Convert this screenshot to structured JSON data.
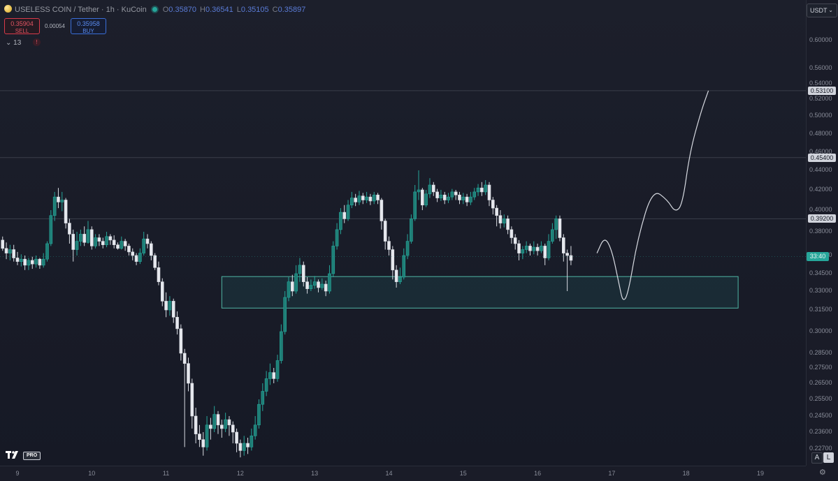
{
  "symbol": {
    "title": "USELESS COIN / Tether · 1h · KuCoin",
    "open_key": "O",
    "open": "0.35870",
    "high_key": "H",
    "high": "0.36541",
    "low_key": "L",
    "low": "0.35105",
    "close_key": "C",
    "close": "0.35897"
  },
  "trade": {
    "sell_price": "0.35904",
    "sell_label": "SELL",
    "spread": "0.00054",
    "buy_price": "0.35958",
    "buy_label": "BUY"
  },
  "indicators_toggle": "⌄ 13",
  "alert_glyph": "!",
  "currency": {
    "label": "USDT",
    "chevron": "⌄"
  },
  "price_axis": {
    "ticks": [
      "0.60000",
      "0.56000",
      "0.54000",
      "0.52000",
      "0.50000",
      "0.48000",
      "0.46000",
      "0.44000",
      "0.42000",
      "0.40000",
      "0.38000",
      "0.36000",
      "0.34500",
      "0.33000",
      "0.31500",
      "0.30000",
      "0.28500",
      "0.27500",
      "0.26500",
      "0.25500",
      "0.24500",
      "0.23600",
      "0.22700"
    ],
    "horizontal_lines": [
      {
        "label": "0.53100",
        "price": 0.531
      },
      {
        "label": "0.45400",
        "price": 0.454
      },
      {
        "label": "0.39200",
        "price": 0.392
      }
    ],
    "countdown": "33:40",
    "last_price": 0.359
  },
  "time_axis": {
    "ticks": [
      "9",
      "10",
      "11",
      "12",
      "13",
      "14",
      "15",
      "16",
      "17",
      "18",
      "19"
    ]
  },
  "support_zone": {
    "top": 0.3425,
    "bottom": 0.3165,
    "from_day": 11.75,
    "to_day": 18.7
  },
  "projection": {
    "points": [
      [
        16.8,
        0.362
      ],
      [
        16.9,
        0.376
      ],
      [
        17.0,
        0.365
      ],
      [
        17.1,
        0.335
      ],
      [
        17.15,
        0.321
      ],
      [
        17.22,
        0.328
      ],
      [
        17.35,
        0.375
      ],
      [
        17.55,
        0.421
      ],
      [
        17.75,
        0.41
      ],
      [
        17.85,
        0.398
      ],
      [
        17.95,
        0.405
      ],
      [
        18.05,
        0.46
      ],
      [
        18.2,
        0.505
      ],
      [
        18.3,
        0.531
      ]
    ]
  },
  "chart_data": {
    "type": "candlestick",
    "title": "USELESS COIN / Tether · 1h · KuCoin",
    "xlabel": "",
    "ylabel": "",
    "ylim": [
      0.22,
      0.61
    ],
    "xlim": [
      8.78,
      19.3
    ],
    "candles": [
      [
        8.8,
        0.373,
        0.366,
        0.376,
        0.364
      ],
      [
        8.85,
        0.366,
        0.362,
        0.371,
        0.357
      ],
      [
        8.9,
        0.362,
        0.365,
        0.369,
        0.356
      ],
      [
        8.95,
        0.365,
        0.358,
        0.369,
        0.355
      ],
      [
        9.0,
        0.358,
        0.355,
        0.363,
        0.352
      ],
      [
        9.05,
        0.355,
        0.357,
        0.361,
        0.351
      ],
      [
        9.1,
        0.357,
        0.352,
        0.36,
        0.348
      ],
      [
        9.15,
        0.352,
        0.356,
        0.358,
        0.348
      ],
      [
        9.2,
        0.356,
        0.353,
        0.359,
        0.349
      ],
      [
        9.25,
        0.353,
        0.357,
        0.36,
        0.35
      ],
      [
        9.3,
        0.357,
        0.352,
        0.358,
        0.349
      ],
      [
        9.35,
        0.352,
        0.357,
        0.362,
        0.35
      ],
      [
        9.4,
        0.357,
        0.37,
        0.372,
        0.355
      ],
      [
        9.45,
        0.37,
        0.395,
        0.4,
        0.368
      ],
      [
        9.5,
        0.395,
        0.413,
        0.418,
        0.39
      ],
      [
        9.55,
        0.413,
        0.408,
        0.422,
        0.402
      ],
      [
        9.6,
        0.408,
        0.41,
        0.418,
        0.399
      ],
      [
        9.65,
        0.41,
        0.388,
        0.412,
        0.383
      ],
      [
        9.7,
        0.388,
        0.378,
        0.392,
        0.37
      ],
      [
        9.75,
        0.378,
        0.365,
        0.382,
        0.355
      ],
      [
        9.8,
        0.365,
        0.372,
        0.38,
        0.36
      ],
      [
        9.85,
        0.372,
        0.378,
        0.382,
        0.368
      ],
      [
        9.9,
        0.378,
        0.371,
        0.385,
        0.368
      ],
      [
        9.95,
        0.371,
        0.382,
        0.39,
        0.37
      ],
      [
        10.0,
        0.382,
        0.368,
        0.385,
        0.365
      ],
      [
        10.05,
        0.368,
        0.375,
        0.378,
        0.366
      ],
      [
        10.1,
        0.375,
        0.372,
        0.378,
        0.368
      ],
      [
        10.15,
        0.372,
        0.369,
        0.375,
        0.366
      ],
      [
        10.2,
        0.369,
        0.376,
        0.38,
        0.367
      ],
      [
        10.25,
        0.376,
        0.373,
        0.378,
        0.369
      ],
      [
        10.3,
        0.373,
        0.369,
        0.377,
        0.366
      ],
      [
        10.35,
        0.369,
        0.366,
        0.371,
        0.365
      ],
      [
        10.4,
        0.366,
        0.372,
        0.376,
        0.365
      ],
      [
        10.45,
        0.372,
        0.368,
        0.374,
        0.364
      ],
      [
        10.5,
        0.368,
        0.363,
        0.37,
        0.36
      ],
      [
        10.55,
        0.363,
        0.36,
        0.366,
        0.356
      ],
      [
        10.6,
        0.36,
        0.355,
        0.362,
        0.352
      ],
      [
        10.65,
        0.355,
        0.362,
        0.366,
        0.353
      ],
      [
        10.7,
        0.362,
        0.374,
        0.38,
        0.36
      ],
      [
        10.75,
        0.374,
        0.37,
        0.378,
        0.366
      ],
      [
        10.8,
        0.37,
        0.36,
        0.372,
        0.356
      ],
      [
        10.85,
        0.36,
        0.35,
        0.362,
        0.348
      ],
      [
        10.9,
        0.35,
        0.338,
        0.355,
        0.335
      ],
      [
        10.95,
        0.338,
        0.322,
        0.341,
        0.318
      ],
      [
        11.0,
        0.322,
        0.315,
        0.329,
        0.31
      ],
      [
        11.05,
        0.315,
        0.322,
        0.326,
        0.311
      ],
      [
        11.1,
        0.322,
        0.31,
        0.324,
        0.306
      ],
      [
        11.15,
        0.31,
        0.302,
        0.314,
        0.298
      ],
      [
        11.2,
        0.302,
        0.285,
        0.305,
        0.28
      ],
      [
        11.25,
        0.285,
        0.278,
        0.288,
        0.228
      ],
      [
        11.3,
        0.278,
        0.265,
        0.282,
        0.26
      ],
      [
        11.35,
        0.265,
        0.245,
        0.268,
        0.238
      ],
      [
        11.4,
        0.245,
        0.235,
        0.25,
        0.23
      ],
      [
        11.45,
        0.235,
        0.232,
        0.24,
        0.228
      ],
      [
        11.5,
        0.232,
        0.228,
        0.236,
        0.223
      ],
      [
        11.55,
        0.228,
        0.24,
        0.245,
        0.226
      ],
      [
        11.6,
        0.24,
        0.238,
        0.244,
        0.232
      ],
      [
        11.65,
        0.238,
        0.246,
        0.251,
        0.236
      ],
      [
        11.7,
        0.246,
        0.24,
        0.248,
        0.235
      ],
      [
        11.75,
        0.24,
        0.238,
        0.243,
        0.233
      ],
      [
        11.8,
        0.238,
        0.243,
        0.247,
        0.236
      ],
      [
        11.85,
        0.243,
        0.24,
        0.245,
        0.234
      ],
      [
        11.9,
        0.24,
        0.236,
        0.242,
        0.23
      ],
      [
        11.95,
        0.236,
        0.23,
        0.238,
        0.225
      ],
      [
        12.0,
        0.23,
        0.226,
        0.232,
        0.222
      ],
      [
        12.05,
        0.226,
        0.23,
        0.234,
        0.223
      ],
      [
        12.1,
        0.23,
        0.228,
        0.233,
        0.224
      ],
      [
        12.15,
        0.228,
        0.234,
        0.238,
        0.226
      ],
      [
        12.2,
        0.234,
        0.24,
        0.245,
        0.232
      ],
      [
        12.25,
        0.24,
        0.252,
        0.255,
        0.238
      ],
      [
        12.3,
        0.252,
        0.26,
        0.265,
        0.248
      ],
      [
        12.35,
        0.26,
        0.268,
        0.273,
        0.257
      ],
      [
        12.4,
        0.268,
        0.272,
        0.278,
        0.264
      ],
      [
        12.45,
        0.272,
        0.268,
        0.275,
        0.265
      ],
      [
        12.5,
        0.268,
        0.28,
        0.284,
        0.266
      ],
      [
        12.55,
        0.28,
        0.3,
        0.305,
        0.278
      ],
      [
        12.6,
        0.3,
        0.325,
        0.33,
        0.298
      ],
      [
        12.65,
        0.325,
        0.338,
        0.342,
        0.322
      ],
      [
        12.7,
        0.338,
        0.33,
        0.344,
        0.326
      ],
      [
        12.75,
        0.33,
        0.345,
        0.352,
        0.328
      ],
      [
        12.8,
        0.345,
        0.352,
        0.358,
        0.338
      ],
      [
        12.85,
        0.352,
        0.338,
        0.355,
        0.334
      ],
      [
        12.9,
        0.338,
        0.332,
        0.342,
        0.328
      ],
      [
        12.95,
        0.332,
        0.335,
        0.34,
        0.33
      ],
      [
        13.0,
        0.335,
        0.338,
        0.343,
        0.332
      ],
      [
        13.05,
        0.338,
        0.333,
        0.34,
        0.329
      ],
      [
        13.1,
        0.333,
        0.336,
        0.341,
        0.331
      ],
      [
        13.15,
        0.336,
        0.33,
        0.339,
        0.326
      ],
      [
        13.2,
        0.33,
        0.345,
        0.352,
        0.328
      ],
      [
        13.25,
        0.345,
        0.368,
        0.372,
        0.342
      ],
      [
        13.3,
        0.368,
        0.382,
        0.388,
        0.365
      ],
      [
        13.35,
        0.382,
        0.398,
        0.402,
        0.378
      ],
      [
        13.4,
        0.398,
        0.392,
        0.405,
        0.388
      ],
      [
        13.45,
        0.392,
        0.405,
        0.41,
        0.39
      ],
      [
        13.5,
        0.405,
        0.412,
        0.418,
        0.402
      ],
      [
        13.55,
        0.412,
        0.408,
        0.416,
        0.404
      ],
      [
        13.6,
        0.408,
        0.414,
        0.419,
        0.405
      ],
      [
        13.65,
        0.414,
        0.41,
        0.417,
        0.406
      ],
      [
        13.7,
        0.41,
        0.413,
        0.418,
        0.407
      ],
      [
        13.75,
        0.413,
        0.409,
        0.416,
        0.405
      ],
      [
        13.8,
        0.409,
        0.415,
        0.418,
        0.406
      ],
      [
        13.85,
        0.415,
        0.41,
        0.417,
        0.406
      ],
      [
        13.9,
        0.41,
        0.39,
        0.412,
        0.382
      ],
      [
        13.95,
        0.39,
        0.372,
        0.392,
        0.365
      ],
      [
        14.0,
        0.372,
        0.365,
        0.376,
        0.36
      ],
      [
        14.05,
        0.365,
        0.348,
        0.368,
        0.34
      ],
      [
        14.1,
        0.348,
        0.338,
        0.352,
        0.333
      ],
      [
        14.15,
        0.338,
        0.342,
        0.35,
        0.336
      ],
      [
        14.2,
        0.342,
        0.36,
        0.366,
        0.34
      ],
      [
        14.25,
        0.36,
        0.372,
        0.378,
        0.357
      ],
      [
        14.3,
        0.372,
        0.392,
        0.396,
        0.37
      ],
      [
        14.35,
        0.392,
        0.418,
        0.425,
        0.39
      ],
      [
        14.4,
        0.418,
        0.42,
        0.44,
        0.41
      ],
      [
        14.45,
        0.42,
        0.405,
        0.422,
        0.4
      ],
      [
        14.5,
        0.405,
        0.416,
        0.42,
        0.403
      ],
      [
        14.55,
        0.416,
        0.425,
        0.432,
        0.412
      ],
      [
        14.6,
        0.425,
        0.418,
        0.428,
        0.414
      ],
      [
        14.65,
        0.418,
        0.412,
        0.421,
        0.408
      ],
      [
        14.7,
        0.412,
        0.415,
        0.42,
        0.409
      ],
      [
        14.75,
        0.415,
        0.41,
        0.418,
        0.406
      ],
      [
        14.8,
        0.41,
        0.413,
        0.417,
        0.407
      ],
      [
        14.85,
        0.413,
        0.418,
        0.421,
        0.41
      ],
      [
        14.9,
        0.418,
        0.415,
        0.42,
        0.41
      ],
      [
        14.95,
        0.415,
        0.41,
        0.418,
        0.406
      ],
      [
        15.0,
        0.41,
        0.413,
        0.417,
        0.406
      ],
      [
        15.05,
        0.413,
        0.408,
        0.416,
        0.404
      ],
      [
        15.1,
        0.408,
        0.413,
        0.418,
        0.405
      ],
      [
        15.15,
        0.413,
        0.418,
        0.422,
        0.41
      ],
      [
        15.2,
        0.418,
        0.422,
        0.426,
        0.414
      ],
      [
        15.25,
        0.422,
        0.418,
        0.428,
        0.414
      ],
      [
        15.3,
        0.418,
        0.425,
        0.43,
        0.415
      ],
      [
        15.35,
        0.425,
        0.41,
        0.428,
        0.404
      ],
      [
        15.4,
        0.41,
        0.402,
        0.413,
        0.396
      ],
      [
        15.45,
        0.402,
        0.395,
        0.405,
        0.385
      ],
      [
        15.5,
        0.395,
        0.388,
        0.4,
        0.383
      ],
      [
        15.55,
        0.388,
        0.392,
        0.396,
        0.384
      ],
      [
        15.6,
        0.392,
        0.382,
        0.395,
        0.378
      ],
      [
        15.65,
        0.382,
        0.375,
        0.385,
        0.37
      ],
      [
        15.7,
        0.375,
        0.37,
        0.378,
        0.365
      ],
      [
        15.75,
        0.37,
        0.362,
        0.373,
        0.356
      ],
      [
        15.8,
        0.362,
        0.365,
        0.368,
        0.357
      ],
      [
        15.85,
        0.365,
        0.368,
        0.372,
        0.362
      ],
      [
        15.9,
        0.368,
        0.364,
        0.37,
        0.36
      ],
      [
        15.95,
        0.364,
        0.367,
        0.372,
        0.361
      ],
      [
        16.0,
        0.367,
        0.364,
        0.37,
        0.36
      ],
      [
        16.05,
        0.364,
        0.368,
        0.372,
        0.362
      ],
      [
        16.1,
        0.368,
        0.358,
        0.37,
        0.352
      ],
      [
        16.15,
        0.358,
        0.372,
        0.378,
        0.356
      ],
      [
        16.2,
        0.372,
        0.382,
        0.388,
        0.37
      ],
      [
        16.25,
        0.382,
        0.392,
        0.395,
        0.374
      ],
      [
        16.3,
        0.392,
        0.375,
        0.395,
        0.372
      ],
      [
        16.35,
        0.375,
        0.362,
        0.378,
        0.355
      ],
      [
        16.4,
        0.362,
        0.36,
        0.365,
        0.33
      ],
      [
        16.45,
        0.36,
        0.356,
        0.368,
        0.352
      ]
    ]
  }
}
